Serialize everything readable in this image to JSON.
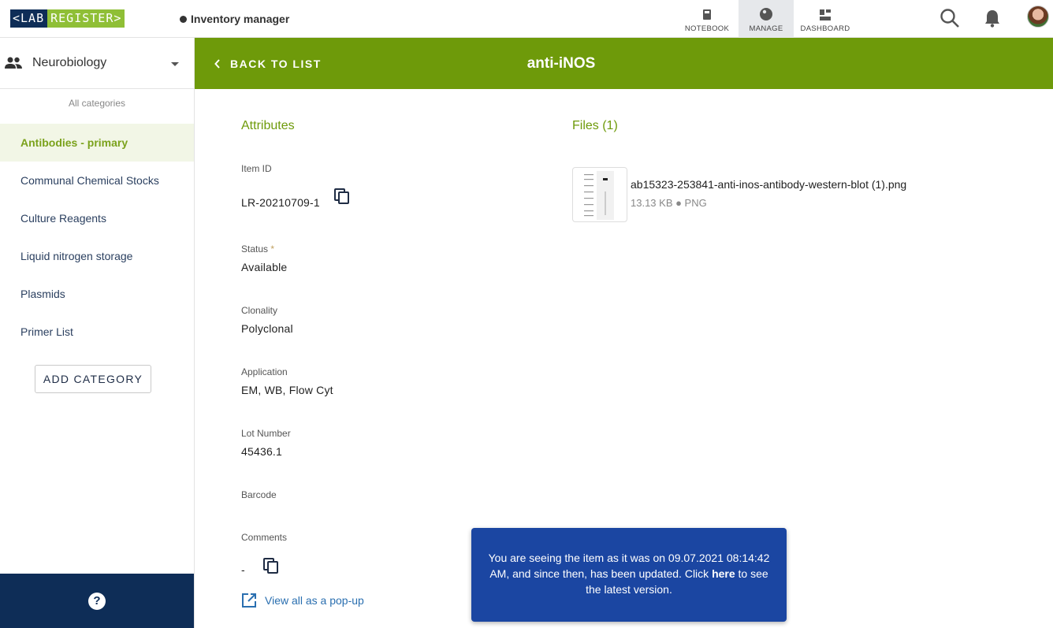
{
  "topbar": {
    "logo_left": "<LAB",
    "logo_right": "REGISTER>",
    "app_name": "Inventory manager",
    "nav": [
      {
        "label": "NOTEBOOK"
      },
      {
        "label": "MANAGE"
      },
      {
        "label": "DASHBOARD"
      }
    ]
  },
  "sidebar": {
    "group_name": "Neurobiology",
    "all_categories": "All categories",
    "categories": [
      {
        "label": "Antibodies - primary"
      },
      {
        "label": "Communal Chemical Stocks"
      },
      {
        "label": "Culture Reagents"
      },
      {
        "label": "Liquid nitrogen storage"
      },
      {
        "label": "Plasmids"
      },
      {
        "label": "Primer List"
      }
    ],
    "add_category": "ADD CATEGORY",
    "help": "?"
  },
  "header": {
    "back_label": "BACK TO LIST",
    "title": "anti-iNOS"
  },
  "attributes": {
    "section_title": "Attributes",
    "item_id_label": "Item ID",
    "item_id_value": "LR-20210709-1",
    "status_label": "Status",
    "status_required": "*",
    "status_value": "Available",
    "clonality_label": "Clonality",
    "clonality_value": "Polyclonal",
    "application_label": "Application",
    "application_value": "EM, WB, Flow Cyt",
    "lot_label": "Lot Number",
    "lot_value": "45436.1",
    "barcode_label": "Barcode",
    "comments_label": "Comments",
    "comments_value": "-",
    "view_popup": "View all as a pop-up"
  },
  "files": {
    "section_title": "Files (1)",
    "items": [
      {
        "name": "ab15323-253841-anti-inos-antibody-western-blot (1).png",
        "meta": "13.13 KB ● PNG"
      }
    ]
  },
  "toast": {
    "line1": "You are seeing the item as it was on 09.07.2021 08:14:42 AM, and since then, has been updated. Click",
    "link": "here",
    "line2": "to see the latest version."
  }
}
